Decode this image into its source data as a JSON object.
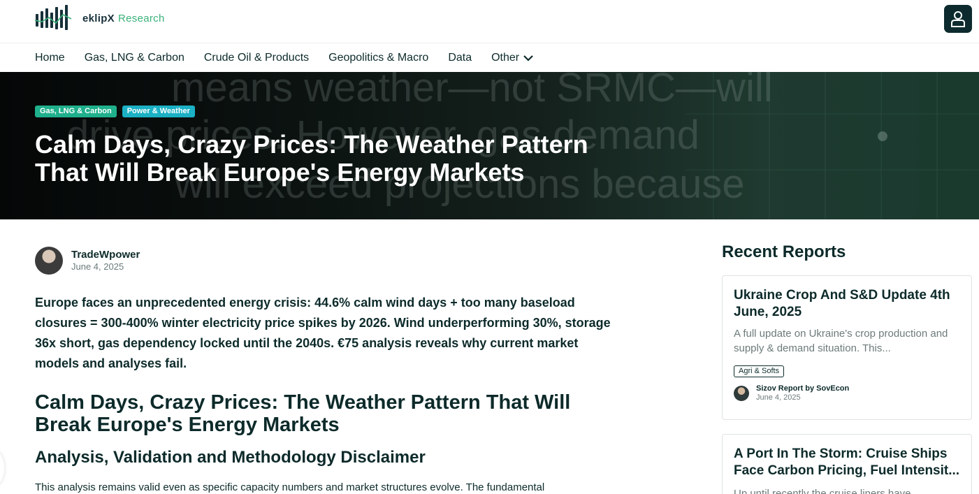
{
  "brand": {
    "name": "eklipX",
    "sub": "Research",
    "logo_icon": "bars-logo-icon",
    "accent": "#3bb27a"
  },
  "header": {
    "account_icon": "user-icon"
  },
  "nav": {
    "items": [
      {
        "label": "Home"
      },
      {
        "label": "Gas, LNG & Carbon"
      },
      {
        "label": "Crude Oil & Products"
      },
      {
        "label": "Geopolitics & Macro"
      },
      {
        "label": "Data"
      },
      {
        "label": "Other",
        "icon": "chevron-down-icon"
      }
    ]
  },
  "hero": {
    "background_text": [
      "means weather—not SRMC—will",
      "drive prices. However, gas demand",
      "will exceed projections because"
    ],
    "tags": [
      {
        "label": "Gas, LNG & Carbon",
        "color": "#1fb08c"
      },
      {
        "label": "Power & Weather",
        "color": "#1bb0c4"
      }
    ],
    "title": "Calm Days, Crazy Prices: The Weather Pattern That Will Break Europe's Energy Markets"
  },
  "article": {
    "author": {
      "name": "TradeWpower",
      "date": "June 4, 2025"
    },
    "lede": "Europe faces an unprecedented energy crisis: 44.6% calm wind days + too many baseload closures = 300-400% winter electricity price spikes by 2026. Wind underperforming 30%, storage 36x short, gas dependency locked until the 2040s. €75 analysis reveals why current market models and analyses fail.",
    "heading": "Calm Days, Crazy Prices: The Weather Pattern That Will Break Europe's Energy Markets",
    "subheading": "Analysis, Validation and Methodology Disclaimer",
    "paragraph": "This analysis remains valid even as specific capacity numbers and market structures evolve. The fundamental"
  },
  "sidebar": {
    "title": "Recent Reports",
    "cards": [
      {
        "title": "Ukraine Crop And S&D Update 4th June, 2025",
        "desc": "A full update on Ukraine's crop production and supply & demand situation. This...",
        "tag": "Agri & Softs",
        "author": "Sizov Report by SovEcon",
        "date": "June 4, 2025"
      },
      {
        "title": "A Port In The Storm: Cruise Ships Face Carbon Pricing, Fuel Intensit...",
        "desc": "Up until recently the cruise liners have"
      }
    ]
  }
}
